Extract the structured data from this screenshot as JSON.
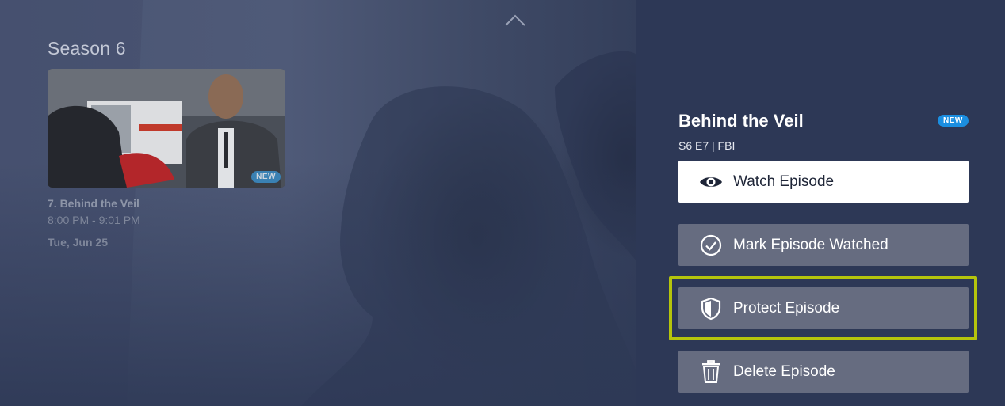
{
  "navigation": {
    "up_icon": "chevron-up-icon"
  },
  "season": {
    "title": "Season 6",
    "episodes": [
      {
        "title": "7. Behind the Veil",
        "time": "8:00 PM - 9:01 PM",
        "date": "Tue, Jun 25",
        "badge": "NEW"
      }
    ]
  },
  "details": {
    "title": "Behind the Veil",
    "badge": "NEW",
    "meta": "S6 E7 | FBI",
    "actions": [
      {
        "label": "Watch Episode",
        "icon": "eye-icon"
      },
      {
        "label": "Mark Episode Watched",
        "icon": "check-circle-icon"
      },
      {
        "label": "Protect Episode",
        "icon": "shield-icon"
      },
      {
        "label": "Delete Episode",
        "icon": "trash-icon"
      }
    ],
    "focused_action": "Protect Episode"
  },
  "colors": {
    "background": "#2d3856",
    "focus": "#b5c40c",
    "new_badge": "#1b8ee0",
    "secondary_button": "#666c80"
  }
}
